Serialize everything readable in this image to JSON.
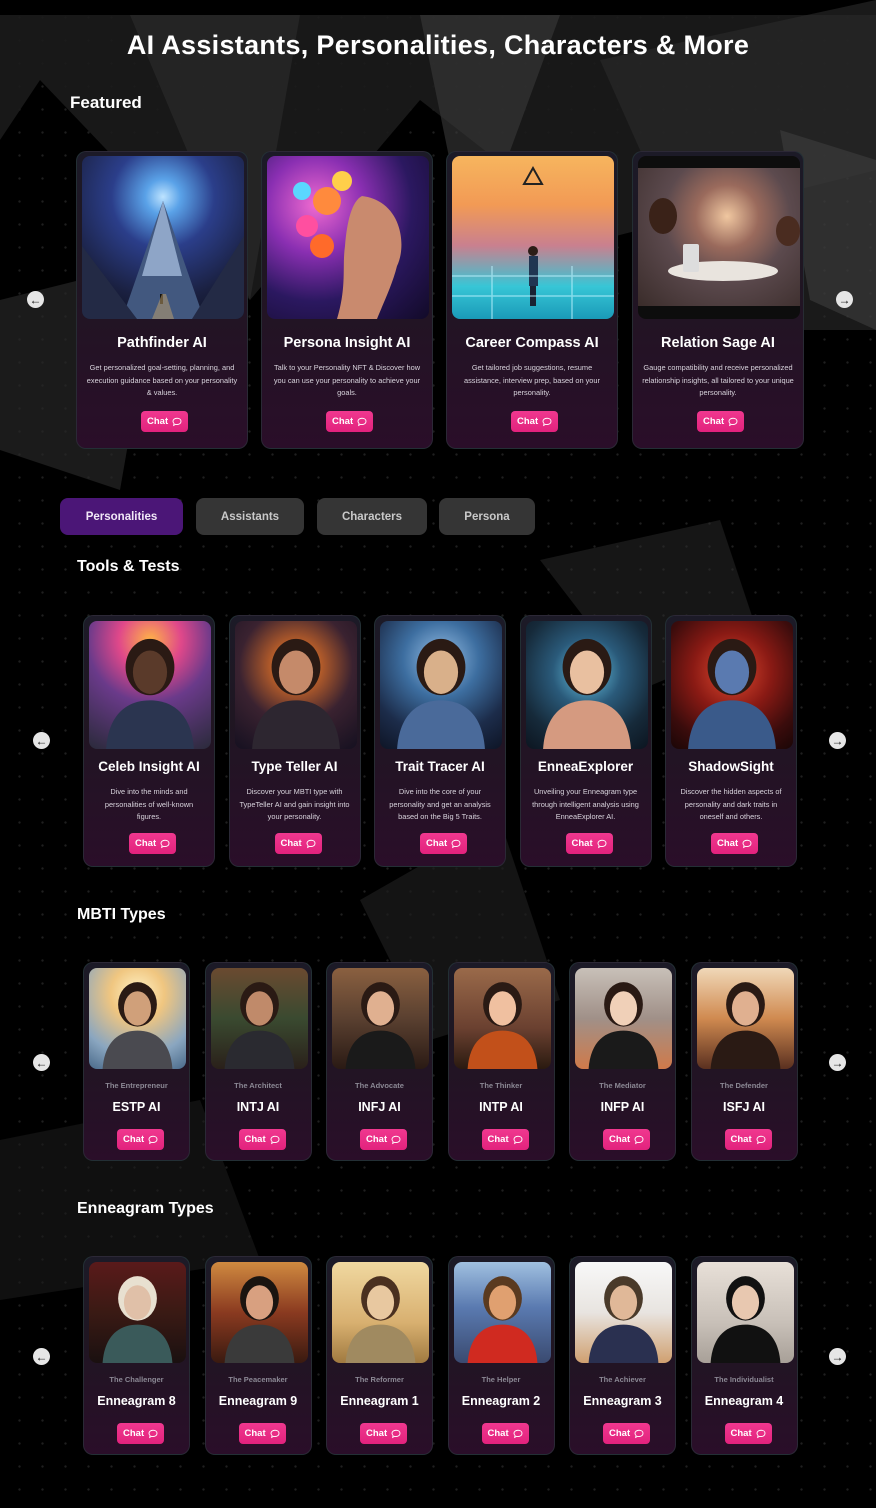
{
  "page": {
    "title": "AI Assistants, Personalities, Characters & More",
    "chat_label": "Chat"
  },
  "featured": {
    "title": "Featured",
    "items": [
      {
        "name": "Pathfinder AI",
        "desc": "Get personalized goal-setting, planning, and execution guidance based on your personality & values.",
        "image": "cosmic-mountain-image"
      },
      {
        "name": "Persona Insight AI",
        "desc": "Talk to your Personality NFT & Discover how you can use your personality to achieve your goals.",
        "image": "floral-profile-image"
      },
      {
        "name": "Career Compass AI",
        "desc": "Get tailored job suggestions, resume assistance, interview prep, based on your personality.",
        "image": "city-maze-image"
      },
      {
        "name": "Relation Sage AI",
        "desc": "Gauge compatibility and receive personalized relationship insights, all tailored to your unique personality.",
        "image": "cafe-couple-image"
      }
    ]
  },
  "tabs": [
    {
      "label": "Personalities",
      "active": true
    },
    {
      "label": "Assistants",
      "active": false
    },
    {
      "label": "Characters",
      "active": false
    },
    {
      "label": "Persona",
      "active": false
    }
  ],
  "tools": {
    "title": "Tools & Tests",
    "items": [
      {
        "name": "Celeb Insight AI",
        "desc": "Dive into the minds and personalities of well-known figures."
      },
      {
        "name": "Type Teller AI",
        "desc": "Discover your MBTI type with TypeTeller AI and gain insight into your personality."
      },
      {
        "name": "Trait Tracer AI",
        "desc": "Dive into the core of your personality and get an analysis based on the Big 5 Traits."
      },
      {
        "name": "EnneaExplorer",
        "desc": "Unveiling your Enneagram type through intelligent analysis using EnneaExplorer AI."
      },
      {
        "name": "ShadowSight",
        "desc": "Discover the hidden aspects of personality and dark traits in oneself and others."
      }
    ]
  },
  "mbti": {
    "title": "MBTI Types",
    "items": [
      {
        "subtitle": "The Entrepreneur",
        "name": "ESTP AI"
      },
      {
        "subtitle": "The Architect",
        "name": "INTJ AI"
      },
      {
        "subtitle": "The Advocate",
        "name": "INFJ AI"
      },
      {
        "subtitle": "The Thinker",
        "name": "INTP AI"
      },
      {
        "subtitle": "The Mediator",
        "name": "INFP AI"
      },
      {
        "subtitle": "The Defender",
        "name": "ISFJ AI"
      }
    ]
  },
  "enneagram": {
    "title": "Enneagram Types",
    "items": [
      {
        "subtitle": "The Challenger",
        "name": "Enneagram 8"
      },
      {
        "subtitle": "The Peacemaker",
        "name": "Enneagram 9"
      },
      {
        "subtitle": "The Reformer",
        "name": "Enneagram 1"
      },
      {
        "subtitle": "The Helper",
        "name": "Enneagram 2"
      },
      {
        "subtitle": "The Achiever",
        "name": "Enneagram 3"
      },
      {
        "subtitle": "The Individualist",
        "name": "Enneagram 4"
      }
    ]
  },
  "colors": {
    "accent_pink": "#e8297f",
    "active_tab": "#4b1677",
    "inactive_tab": "#353535"
  }
}
